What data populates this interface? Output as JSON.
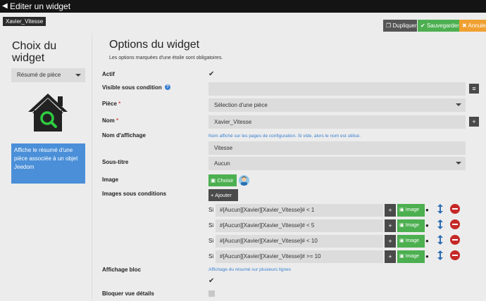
{
  "window": {
    "title": "Editer un widget"
  },
  "header": {
    "widget_name": "Xavier_Vitesse",
    "duplicate_label": "Dupliquer",
    "save_label": "Sauvegarder",
    "cancel_label": "Annuler"
  },
  "left": {
    "title_line1": "Choix du",
    "title_line2": "widget",
    "selected_type": "Résumé de pièce",
    "description": "Affiche le résumé d'une pièce associée à un objet Jeedom"
  },
  "main": {
    "title": "Options du widget",
    "subtitle": "Les options marquées d'une étoile sont obligatoires.",
    "actif_label": "Actif",
    "actif_checked": true,
    "visible_label": "Visible sous condition",
    "visible_value": "",
    "piece_label": "Pièce",
    "piece_value": "Sélection d'une pièce",
    "nom_label": "Nom",
    "nom_value": "Xavier_Vitesse",
    "nom_affichage_label": "Nom d'affichage",
    "nom_affichage_help": "Nom affiché sur les pages de configuration. Si vide, alors le nom est utilisé.",
    "nom_affichage_value": "Vitesse",
    "sous_titre_label": "Sous-titre",
    "sous_titre_value": "Aucun",
    "image_label": "Image",
    "choisir_label": "Choisir",
    "images_cond_label": "Images sous conditions",
    "ajouter_label": "Ajouter",
    "si_label": "Si",
    "image_btn_label": "Image",
    "conditions": [
      {
        "expr": "#[Aucun][Xavier][Xavier_Vitesse]# < 1"
      },
      {
        "expr": "#[Aucun][Xavier][Xavier_Vitesse]# < 5"
      },
      {
        "expr": "#[Aucun][Xavier][Xavier_Vitesse]# < 10"
      },
      {
        "expr": "#[Aucun][Xavier][Xavier_Vitesse]# >= 10"
      }
    ],
    "affichage_bloc_label": "Affichage bloc",
    "affichage_bloc_help": "Affichage du résumé sur plusieurs lignes",
    "affichage_bloc_checked": true,
    "bloquer_label": "Bloquer vue détails",
    "bloquer_checked": false
  },
  "colors": {
    "accent_blue": "#4a8fd8",
    "save_green": "#4caf50",
    "cancel_orange": "#f0a030",
    "delete_red": "#c62828"
  }
}
